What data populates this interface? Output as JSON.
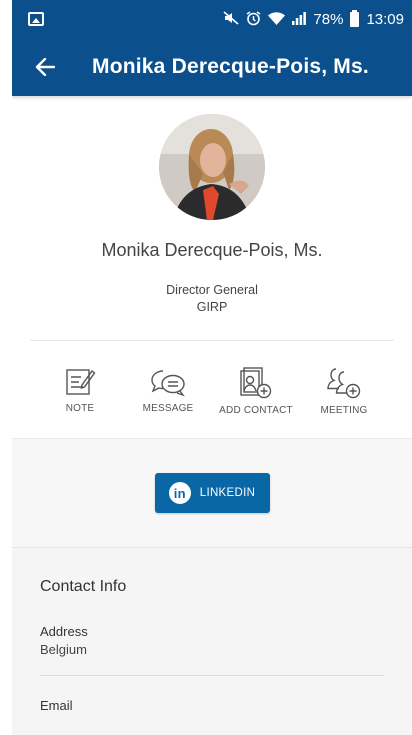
{
  "status_bar": {
    "battery_percent": "78%",
    "time": "13:09",
    "icons": [
      "image-icon",
      "mute-icon",
      "alarm-icon",
      "wifi-icon",
      "signal-icon",
      "battery-icon"
    ]
  },
  "app_bar": {
    "title": "Monika Derecque-Pois, Ms.",
    "back_icon": "back-arrow-icon",
    "color": "#0b4f8c"
  },
  "profile": {
    "name": "Monika Derecque-Pois, Ms.",
    "job_title": "Director General",
    "organization": "GIRP"
  },
  "actions": [
    {
      "label": "NOTE",
      "icon": "note-icon"
    },
    {
      "label": "MESSAGE",
      "icon": "message-icon"
    },
    {
      "label": "ADD CONTACT",
      "icon": "add-contact-icon"
    },
    {
      "label": "MEETING",
      "icon": "meeting-icon"
    }
  ],
  "linkedin": {
    "label": "LINKEDIN",
    "badge": "in",
    "color": "#0a67a6"
  },
  "contact_info": {
    "heading": "Contact Info",
    "address_label": "Address",
    "address_value": "Belgium",
    "email_label": "Email"
  }
}
